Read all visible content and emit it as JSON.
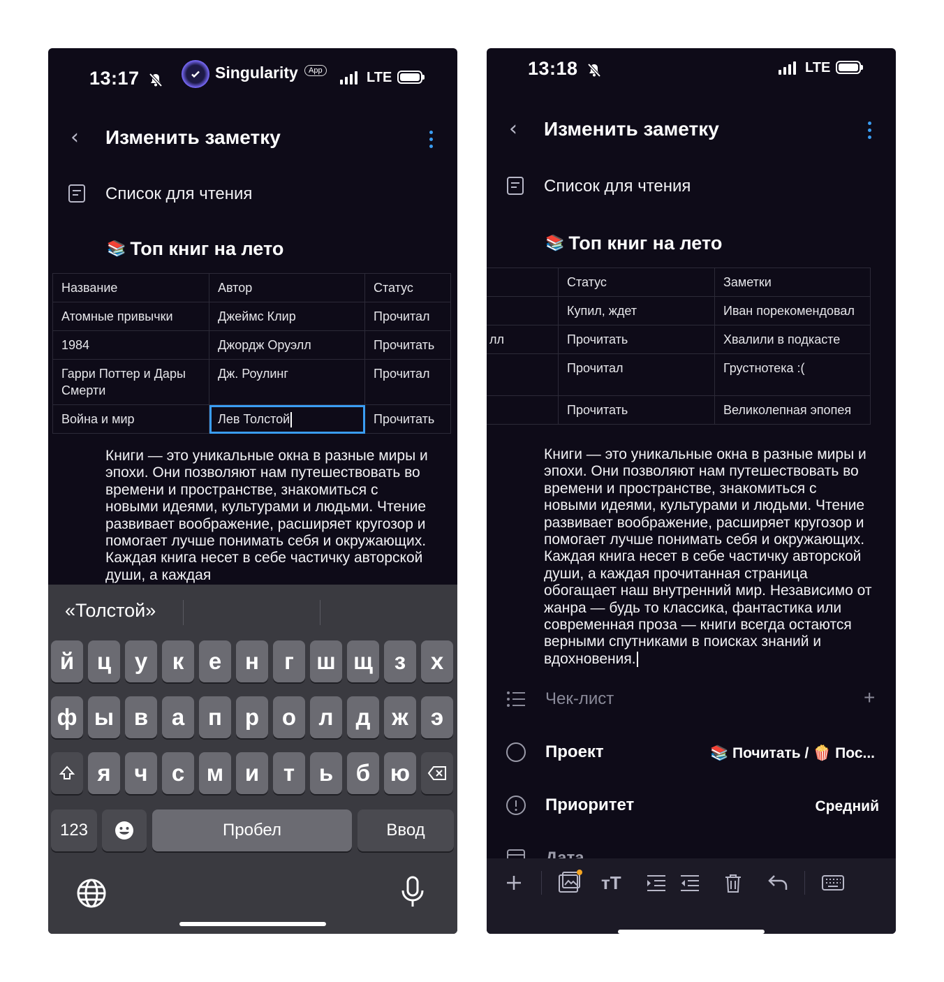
{
  "left": {
    "status": {
      "time": "13:17",
      "app_name": "Singularity",
      "app_badge": "App",
      "network": "LTE"
    },
    "header": {
      "title": "Изменить заметку",
      "back": "‹"
    },
    "list_name": "Список для чтения",
    "heading": {
      "emoji": "📚",
      "text": "Топ книг на лето"
    },
    "table": {
      "header": [
        "Название",
        "Автор",
        "Статус"
      ],
      "rows": [
        [
          "Атомные привычки",
          "Джеймс Клир",
          "Прочитал"
        ],
        [
          "1984",
          "Джордж Оруэлл",
          "Прочитать"
        ],
        [
          "Гарри Поттер и Дары Смерти",
          "Дж. Роулинг",
          "Прочитал"
        ],
        [
          "Война и мир",
          "Лев Толстой",
          "Прочитать"
        ]
      ]
    },
    "body_text": "Книги — это уникальные окна в разные миры и эпохи. Они позволяют нам путешествовать во времени и пространстве, знакомиться с новыми идеями, культурами и людьми. Чтение развивает воображение, расширяет кругозор и помогает лучше понимать себя и окружающих. Каждая книга несет в себе частичку авторской души, а каждая",
    "keyboard": {
      "suggestion": "«Толстой»",
      "row1": [
        "й",
        "ц",
        "у",
        "к",
        "е",
        "н",
        "г",
        "ш",
        "щ",
        "з",
        "х"
      ],
      "row2": [
        "ф",
        "ы",
        "в",
        "а",
        "п",
        "р",
        "о",
        "л",
        "д",
        "ж",
        "э"
      ],
      "row3": [
        "я",
        "ч",
        "с",
        "м",
        "и",
        "т",
        "ь",
        "б",
        "ю"
      ],
      "numbers": "123",
      "space": "Пробел",
      "enter": "Ввод"
    }
  },
  "right": {
    "status": {
      "time": "13:18",
      "network": "LTE"
    },
    "header": {
      "title": "Изменить заметку",
      "back": "‹"
    },
    "list_name": "Список для чтения",
    "heading": {
      "emoji": "📚",
      "text": "Топ книг на лето"
    },
    "table": {
      "first_col_cut": [
        "",
        "",
        "лл",
        "",
        ""
      ],
      "header": [
        "Статус",
        "Заметки"
      ],
      "rows": [
        [
          "Купил, ждет",
          "Иван порекомендовал"
        ],
        [
          "Прочитать",
          "Хвалили в подкасте"
        ],
        [
          "Прочитал",
          "Грустнотека :("
        ],
        [
          "Прочитать",
          "Великолепная эпопея"
        ]
      ]
    },
    "body_text": "Книги — это уникальные окна в разные миры и эпохи. Они позволяют нам путешествовать во времени и пространстве, знакомиться с новыми идеями, культурами и людьми. Чтение развивает воображение, расширяет кругозор и помогает лучше понимать себя и окружающих. Каждая книга несет в себе частичку авторской души, а каждая прочитанная страница обогащает наш внутренний мир. Независимо от жанра — будь то классика, фантастика или современная проза — книги всегда остаются верными спутниками в поисках знаний и вдохновения.",
    "checklist": {
      "label": "Чек-лист",
      "add": "+"
    },
    "project": {
      "label": "Проект",
      "value": "📚 Почитать / 🍿 Пос..."
    },
    "priority": {
      "label": "Приоритет",
      "value": "Средний"
    },
    "date": {
      "label": "Дата"
    }
  }
}
